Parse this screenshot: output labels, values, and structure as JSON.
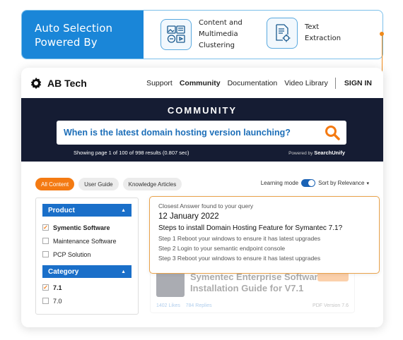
{
  "banner": {
    "title_line1": "Auto Selection",
    "title_line2": "Powered By",
    "feature1": {
      "line1": "Content and",
      "line2": "Multimedia",
      "line3": "Clustering",
      "icon": "media-cluster-icon"
    },
    "feature2": {
      "line1": "Text",
      "line2": "Extraction",
      "icon": "document-gear-icon"
    }
  },
  "nav": {
    "brand": "AB Tech",
    "links": [
      "Support",
      "Community",
      "Documentation",
      "Video Library"
    ],
    "signin": "SIGN IN"
  },
  "hero": {
    "title": "COMMUNITY",
    "query": "When is the latest domain hosting version launching?",
    "results_text": "Showing page 1 of 100 of 998 results (0.807 sec)",
    "powered_label": "Powered by",
    "powered_brand": "SearchUnify"
  },
  "filters": {
    "tabs": [
      "All Content",
      "User Guide",
      "Knowledge Articles"
    ],
    "learning_mode": "Learning mode",
    "sort": "Sort by Relevance"
  },
  "facets": {
    "product": {
      "title": "Product",
      "items": [
        "Symentic Software",
        "Maintenance Software",
        "PCP Solution"
      ],
      "checked": [
        true,
        false,
        false
      ]
    },
    "category": {
      "title": "Category",
      "items": [
        "7.1",
        "7.0"
      ],
      "checked": [
        true,
        false
      ]
    }
  },
  "result": {
    "title_line1": "Symentec Enterprise Software",
    "title_line2": "Installation Guide for V7.1",
    "likes": "1402 Likes",
    "replies": "784 Replies",
    "version": "PDF Version 7.6"
  },
  "answer": {
    "label": "Closest Answer found to your query",
    "date": "12 January 2022",
    "title": "Steps to install Domain Hosting Feature for Symantec 7.1?",
    "steps": [
      "Step 1 Reboot your windows to ensure it has latest upgrades",
      "Step 2 Login to your semantic endpoint console",
      "Step 3 Reboot your windows to ensure it has latest upgrades"
    ]
  },
  "colors": {
    "accent_orange": "#f47a12",
    "brand_blue": "#1a86d8",
    "hero_bg": "#151c33"
  }
}
